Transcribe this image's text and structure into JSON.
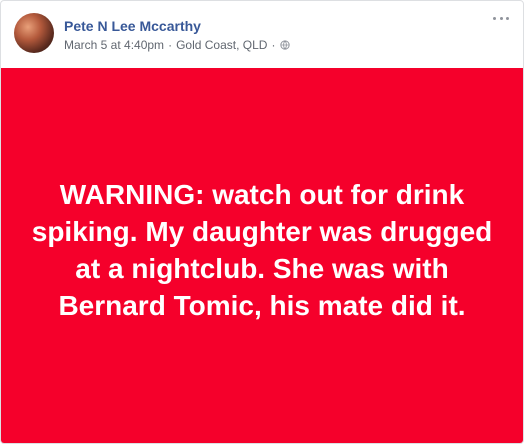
{
  "post": {
    "author": "Pete N Lee Mccarthy",
    "date": "March 5 at 4:40pm",
    "separator": "·",
    "location": "Gold Coast, QLD",
    "separator2": "·",
    "privacy_icon": "globe-icon",
    "more_icon": "more-options-icon",
    "image_text": "WARNING: watch out for drink spiking. My daughter was drugged at a nightclub. She was with Bernard Tomic, his mate did it.",
    "image_background": "#f5002b",
    "link_color": "#385898"
  }
}
